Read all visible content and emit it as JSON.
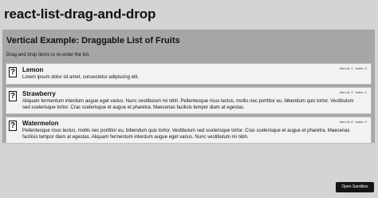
{
  "page": {
    "title": "react-list-drag-and-drop"
  },
  "panel": {
    "heading": "Vertical Example: Draggable List of Fruits",
    "subtext": "Drag and drop items to re-order the list."
  },
  "items": [
    {
      "icon": "question-mark-icon",
      "glyph": "?",
      "title": "Lemon",
      "text": "Lorem ipsum dolor sit amet, consectetur adipiscing elit.",
      "meta": "item.id: 1 · index: 0"
    },
    {
      "icon": "question-mark-icon",
      "glyph": "?",
      "title": "Strawberry",
      "text": "Aliquam fermentum interdum augue eget varius. Nunc vestibulum mi nibh. Pellentesque risus lectus, mollis nec porttitor eu, bibendum quis tortor. Vestibulum sed scelerisque tortor. Cras scelerisque et augue et pharetra. Maecenas facilisis tempor diam at egestas.",
      "meta": "item.id: 3 · index: 1"
    },
    {
      "icon": "question-mark-icon",
      "glyph": "?",
      "title": "Watermelon",
      "text": "Pellentesque risus lectus, mollis nec porttitor eu, bibendum quis tortor. Vestibulum sed scelerisque tortor. Cras scelerisque et augue et pharetra. Maecenas facilisis tempor diam at egestas. Aliquam fermentum interdum augue eget varius. Nunc vestibulum mi nibh.",
      "meta": "item.id: 8 · index: 2"
    }
  ],
  "sandbox": {
    "label": "Open Sandbox"
  },
  "colors": {
    "panel": "#a6a6a6",
    "background": "#d4d4d4",
    "item": "#f2f2f2",
    "button": "#151515"
  }
}
